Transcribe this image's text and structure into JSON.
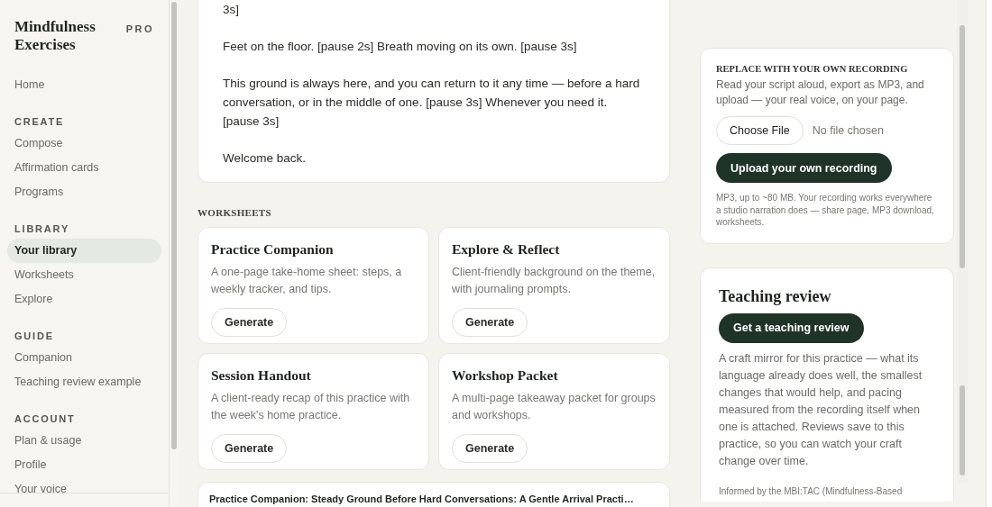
{
  "app": {
    "title": "Mindfulness Exercises",
    "badge": "PRO"
  },
  "sidebar": {
    "sections": [
      {
        "items": [
          {
            "label": "Home",
            "selected": false
          }
        ]
      },
      {
        "heading": "CREATE",
        "items": [
          {
            "label": "Compose",
            "selected": false
          },
          {
            "label": "Affirmation cards",
            "selected": false
          },
          {
            "label": "Programs",
            "selected": false
          }
        ]
      },
      {
        "heading": "LIBRARY",
        "items": [
          {
            "label": "Your library",
            "selected": true
          },
          {
            "label": "Worksheets",
            "selected": false
          },
          {
            "label": "Explore",
            "selected": false
          }
        ]
      },
      {
        "heading": "GUIDE",
        "items": [
          {
            "label": "Companion",
            "selected": false
          },
          {
            "label": "Teaching review example",
            "selected": false
          }
        ]
      },
      {
        "heading": "ACCOUNT",
        "items": [
          {
            "label": "Plan & usage",
            "selected": false
          },
          {
            "label": "Profile",
            "selected": false
          },
          {
            "label": "Your voice",
            "selected": false
          }
        ]
      }
    ]
  },
  "script": {
    "paragraphs": [
      "3s]",
      "Feet on the floor. [pause 2s] Breath moving on its own. [pause 3s]",
      "This ground is always here, and you can return to it any time — before a hard conversation, or in the middle of one. [pause 3s] Whenever you need it. [pause 3s]",
      "Welcome back."
    ]
  },
  "worksheets": {
    "heading": "WORKSHEETS",
    "cards": [
      {
        "title": "Practice Companion",
        "description": "A one-page take-home sheet: steps, a weekly tracker, and tips.",
        "button": "Generate"
      },
      {
        "title": "Explore & Reflect",
        "description": "Client-friendly background on the theme, with journaling prompts.",
        "button": "Generate"
      },
      {
        "title": "Session Handout",
        "description": "A client-ready recap of this practice with the week's home practice.",
        "button": "Generate"
      },
      {
        "title": "Workshop Packet",
        "description": "A multi-page takeaway packet for groups and workshops.",
        "button": "Generate"
      }
    ]
  },
  "companion_card": {
    "title": "Practice Companion: Steady Ground Before Hard Conversations: A Gentle Arrival Practi…"
  },
  "recording": {
    "heading": "REPLACE WITH YOUR OWN RECORDING",
    "description": "Read your script aloud, export as MP3, and upload — your real voice, on your page.",
    "file_button": "Choose File",
    "file_status": "No file chosen",
    "upload_button": "Upload your own recording",
    "note": "MP3, up to ~80 MB. Your recording works everywhere a studio narration does — share page, MP3 download, worksheets."
  },
  "review": {
    "title": "Teaching review",
    "button": "Get a teaching review",
    "description": "A craft mirror for this practice — what its language already does well, the smallest changes that would help, and pacing measured from the recording itself when one is attached. Reviews save to this practice, so you can watch your craft change over time.",
    "footnote": "Informed by the MBI:TAC (Mindfulness-Based"
  }
}
